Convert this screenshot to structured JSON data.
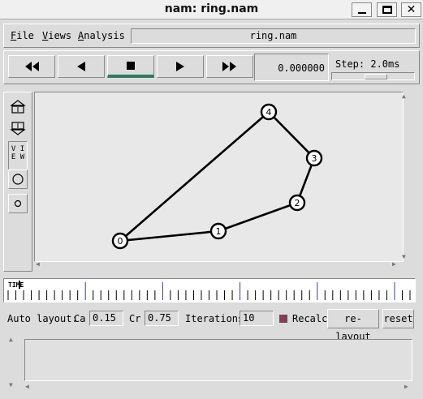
{
  "window": {
    "title": "nam: ring.nam",
    "controls": [
      "minimize",
      "maximize",
      "close"
    ]
  },
  "menubar": {
    "file": {
      "mnemonic": "F",
      "rest": "ile"
    },
    "views": {
      "mnemonic": "V",
      "rest": "iews"
    },
    "analysis": {
      "mnemonic": "A",
      "rest": "nalysis"
    },
    "filename": "ring.nam"
  },
  "transport": {
    "buttons": [
      {
        "name": "fast-rewind",
        "icon": "fast-rewind-icon",
        "active": false
      },
      {
        "name": "play-backward",
        "icon": "play-backward-icon",
        "active": false
      },
      {
        "name": "stop",
        "icon": "stop-icon",
        "active": true
      },
      {
        "name": "play-forward",
        "icon": "play-forward-icon",
        "active": false
      },
      {
        "name": "fast-forward",
        "icon": "fast-forward-icon",
        "active": false
      }
    ],
    "time_value": "0.000000",
    "step_label": "Step: 2.0ms"
  },
  "tools": {
    "zoom_in_icon": "zoom-in-icon",
    "zoom_out_icon": "zoom-out-icon",
    "view_label_line1": "V I",
    "view_label_line2": "E W",
    "large_node_icon": "large-circle-icon",
    "small_node_icon": "small-circle-icon"
  },
  "topology": {
    "nodes": [
      {
        "id": "0",
        "label": "0"
      },
      {
        "id": "1",
        "label": "1"
      },
      {
        "id": "2",
        "label": "2"
      },
      {
        "id": "3",
        "label": "3"
      },
      {
        "id": "4",
        "label": "4"
      }
    ],
    "links": [
      [
        "0",
        "1"
      ],
      [
        "1",
        "2"
      ],
      [
        "2",
        "3"
      ],
      [
        "3",
        "4"
      ],
      [
        "4",
        "0"
      ]
    ]
  },
  "timeslider": {
    "label": "TIME",
    "tick_count": 53,
    "major_every": 10
  },
  "autolayout": {
    "label": "Auto layout:",
    "ca_label": "Ca",
    "ca_value": "0.15",
    "cr_label": "Cr",
    "cr_value": "0.75",
    "iterations_label": "Iterations",
    "iterations_value": "10",
    "recalc_label": "Recalc",
    "recalc_checked": true,
    "relayout_label": "re-layout",
    "reset_label": "reset"
  },
  "colors": {
    "active_accent": "#2e7a63",
    "major_tick": "#3a3aa0",
    "recalc_check": "#8b3a5a"
  }
}
